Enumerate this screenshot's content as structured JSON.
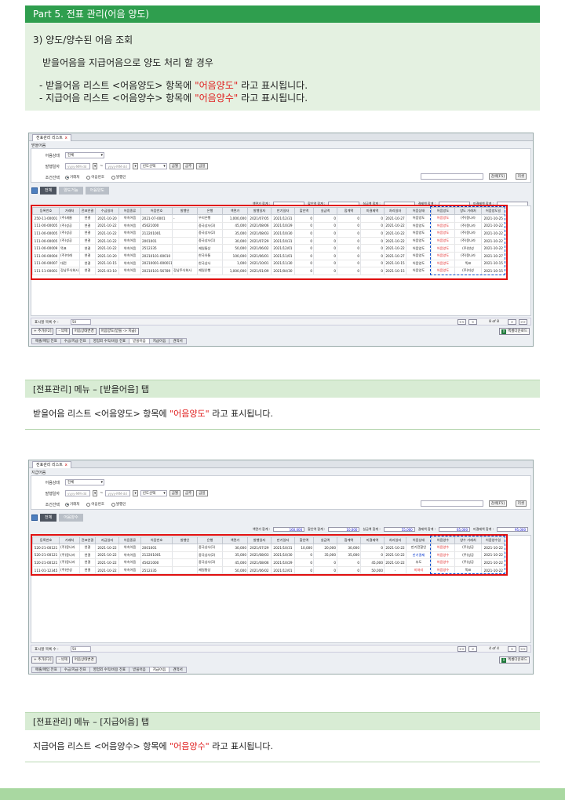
{
  "part_header": "Part 5. 전표 관리(어음 양도)",
  "intro": {
    "heading": "3) 양도/양수된 어음 조회",
    "sub": "받을어음을 지급어음으로 양도 처리 할 경우",
    "bullet1_pre": "- 받을어음 리스트 <어음양도> 항목에 ",
    "bullet1_red": "\"어음양도\"",
    "bullet1_post": " 라고 표시됩니다.",
    "bullet2_pre": "- 지급어음 리스트 <어음양수> 항목에 ",
    "bullet2_red": "\"어음양수\"",
    "bullet2_post": " 라고 표시됩니다."
  },
  "screens": [
    {
      "window_tab": "전표관리 리스트",
      "close": "x",
      "crumb": "받을어음",
      "form": {
        "status_label": "어음상태",
        "status_value": "전체",
        "date_label": "발행일자",
        "date_placeholder": "yyyy-MM-dd",
        "tilde": "~",
        "year_select": "년도선택",
        "btn_prev_month": "금월",
        "btn_this_week": "금주",
        "btn_today": "금일",
        "cond_label": "조건선택",
        "radio1": "거래처",
        "radio2": "어음번호",
        "radio3": "발행인",
        "search_btn": "검색[F5]",
        "reset_btn": "리셋"
      },
      "subtabs": [
        "전체",
        "양도거능",
        "어음양도"
      ],
      "totals": [
        "액면가 합계 :",
        "할인액 합계 :",
        "실금액 합계 :",
        "결제액 합계 :",
        "미결제액 합계 :"
      ],
      "columns": [
        "등록번호",
        "거래처",
        "전표연결",
        "수금일자",
        "어음종류",
        "어음번호",
        "발행인",
        "은행",
        "액면가",
        "발행일자",
        "만기일자",
        "할인액",
        "실금액",
        "합계액",
        "미결제액",
        "처리일자",
        "어음상태",
        "어음양도",
        "양도 거래처",
        "어음양도일"
      ],
      "rows": [
        [
          "250-11-00001",
          "(주)새롬",
          "연결",
          "2021-10-20",
          "약속어음",
          "2021-07-0001",
          "-",
          "우리은행",
          "1,000,000",
          "2021/07/05",
          "2021/12/31",
          "0",
          "0",
          "0",
          "0",
          "2021-10-27",
          "어음양도",
          "어음양도",
          "(주)몽나라",
          "2021-10-25"
        ],
        [
          "111-00-00005",
          "(주)성공",
          "연결",
          "2021-10-22",
          "약속어음",
          "45621000",
          "",
          "중국상사(3)",
          "45,000",
          "2021/08/06",
          "2021/10/29",
          "0",
          "0",
          "0",
          "0",
          "2021-10-22",
          "어음양도",
          "어음양도",
          "(주)몽나라",
          "2021-10-22"
        ],
        [
          "111-00-00005",
          "(주)성공",
          "연결",
          "2021-10-22",
          "약속어음",
          "212201001",
          "",
          "중국상사(2)",
          "35,000",
          "2021/08/03",
          "2021/10/30",
          "0",
          "0",
          "0",
          "0",
          "2021-10-22",
          "어음양도",
          "어음양도",
          "(주)몽나라",
          "2021-10-22"
        ],
        [
          "111-00-00005",
          "(주)성공",
          "연결",
          "2021-10-22",
          "약속어음",
          "2001001",
          "",
          "중국상사(1)",
          "30,000",
          "2021/07/29",
          "2021/10/31",
          "0",
          "0",
          "0",
          "0",
          "2021-10-22",
          "어음양도",
          "어음양도",
          "(주)몽나라",
          "2021-10-22"
        ],
        [
          "111-00-00009",
          "뚝표",
          "연결",
          "2021-10-22",
          "약속어음",
          "2512335",
          "",
          "제일통상",
          "50,000",
          "2021/06/02",
          "2021/12/01",
          "0",
          "0",
          "0",
          "0",
          "2021-10-22",
          "어음양도",
          "어음양도",
          "(주)한성",
          "2021-10-22"
        ],
        [
          "111-00-00004",
          "(주)미래",
          "연결",
          "2021-10-20",
          "약속어음",
          "20210101-00010",
          "",
          "한국유통",
          "100,000",
          "2021/06/01",
          "2021/11/01",
          "0",
          "0",
          "0",
          "0",
          "2021-10-27",
          "어음양도",
          "어음양도",
          "(주)몽나라",
          "2021-10-27"
        ],
        [
          "111-00-00007",
          "대전",
          "연결",
          "2021-10-15",
          "약속어음",
          "20210001-000011",
          "",
          "한국상사",
          "1,000",
          "2021/10/01",
          "2021/11/30",
          "0",
          "0",
          "0",
          "0",
          "2021-10-15",
          "어음양도",
          "어음양도",
          "뚝표",
          "2021-10-15"
        ],
        [
          "111-11-00001",
          "강남주식회사",
          "연결",
          "2021-03-10",
          "약속어음",
          "20210101-56789",
          "강남주식회사",
          "제일은행",
          "1,000,000",
          "2021/01/09",
          "2021/04/30",
          "0",
          "0",
          "0",
          "0",
          "2021-10-15",
          "어음양도",
          "어음양도",
          "(주)지성",
          "2021-10-15"
        ]
      ],
      "pager": {
        "label": "표시할 목록 수 :",
        "size": "50",
        "first": "<<",
        "prev": "<",
        "info": "8 of 8",
        "next": ">",
        "last": ">>"
      },
      "actions": [
        "+ 추가[F2]",
        "- 삭제",
        "어음상태변경",
        "어음양도(받을 -> 지급)"
      ],
      "excel_label": "엑셀다운로드",
      "excel_icon": "X",
      "bottom_tabs": [
        "매출/매입 전표",
        "수금/지급 전표",
        "영업외 수익/비용 전표",
        "받을어음",
        "지급어음",
        "견적서"
      ],
      "active_bottom": 3
    },
    {
      "window_tab": "전표관리 리스트",
      "close": "x",
      "crumb": "지급어음",
      "form": {
        "status_label": "어음상태",
        "status_value": "전체",
        "date_label": "발행일자",
        "date_placeholder": "yyyy-MM-dd",
        "tilde": "~",
        "year_select": "년도선택",
        "btn_prev_month": "금월",
        "btn_this_week": "금주",
        "btn_today": "금일",
        "cond_label": "조건선택",
        "radio1": "거래처",
        "radio2": "어음번호",
        "radio3": "발행인",
        "search_btn": "검색[F5]",
        "reset_btn": "리셋"
      },
      "subtabs": [
        "전체",
        "어음양수"
      ],
      "totals": [
        "액면가 합계 :",
        "할인액 합계 :",
        "실금액 합계 :",
        "결제액 합계 :",
        "미결제액 합계 :"
      ],
      "total_values": [
        "160,000",
        "10,000",
        "55,000",
        "65,000",
        "95,000"
      ],
      "columns": [
        "등록번호",
        "거래처",
        "전표연결",
        "지급일자",
        "어음종류",
        "어음번호",
        "발행인",
        "은행",
        "액면가",
        "발행일자",
        "만기일자",
        "할인액",
        "실금액",
        "합계액",
        "미결제액",
        "처리일자",
        "어음상태",
        "어음양수",
        "양수 거래처",
        "어음양수일"
      ],
      "rows": [
        [
          "520-21-00121",
          "(주)몽나라",
          "연결",
          "2021-10-22",
          "약속어음",
          "2001001",
          "",
          "중국상사(1)",
          "30,000",
          "2021/07/29",
          "2021/10/31",
          "10,000",
          "20,000",
          "30,000",
          "0",
          "2021-10-22",
          "만기전할인",
          "어음양수",
          "(주)성공",
          "2021-10-22"
        ],
        [
          "520-21-00121",
          "(주)몽나라",
          "연결",
          "2021-10-22",
          "약속어음",
          "212201001",
          "",
          "중국상사(2)",
          "35,000",
          "2021/08/03",
          "2021/10/30",
          "0",
          "35,000",
          "35,000",
          "0",
          "2021-10-22",
          "만기결제",
          "어음양수",
          "(주)성공",
          "2021-10-22"
        ],
        [
          "520-21-00121",
          "(주)몽나라",
          "연결",
          "2021-10-22",
          "약속어음",
          "45621000",
          "",
          "중국상사(3)",
          "45,000",
          "2021/08/06",
          "2021/10/29",
          "0",
          "0",
          "0",
          "45,000",
          "2021-10-22",
          "부도",
          "어음양수",
          "(주)성공",
          "2021-10-22"
        ],
        [
          "111-01-12345",
          "(주)한성",
          "연결",
          "2021-10-22",
          "약속어음",
          "2512335",
          "",
          "제일통상",
          "50,000",
          "2021/06/02",
          "2021/12/01",
          "0",
          "0",
          "0",
          "50,000",
          "-",
          "미처리",
          "어음양수",
          "뚝표",
          "2021-10-22"
        ]
      ],
      "pager": {
        "label": "표시할 목록 수 :",
        "size": "50",
        "first": "<<",
        "prev": "<",
        "info": "4 of 4",
        "next": ">",
        "last": ">>"
      },
      "actions": [
        "+ 추가[F2]",
        "- 삭제",
        "어음상태변경"
      ],
      "excel_label": "엑셀다운로드",
      "excel_icon": "X",
      "bottom_tabs": [
        "매출/매입 전표",
        "수금/지급 전표",
        "영업외 수익/비용 전표",
        "받을어음",
        "지급어음",
        "견적서"
      ],
      "active_bottom": 4
    }
  ],
  "section1": {
    "header": "[전표관리] 메뉴 – [받을어음] 탭",
    "body_pre": "받을어음 리스트 <어음양도> 항목에 ",
    "body_red": "\"어음양도\"",
    "body_post": " 라고 표시됩니다."
  },
  "section2": {
    "header": "[전표관리] 메뉴 – [지급어음] 탭",
    "body_pre": "지급어음 리스트 <어음양수> 항목에 ",
    "body_red": "\"어음양수\"",
    "body_post": " 라고 표시됩니다."
  },
  "colors": {
    "header_green": "#2f9e4e",
    "intro_bg": "#e4f1e1",
    "highlight_red": "#e02020",
    "dashed_blue": "#1050d0"
  }
}
